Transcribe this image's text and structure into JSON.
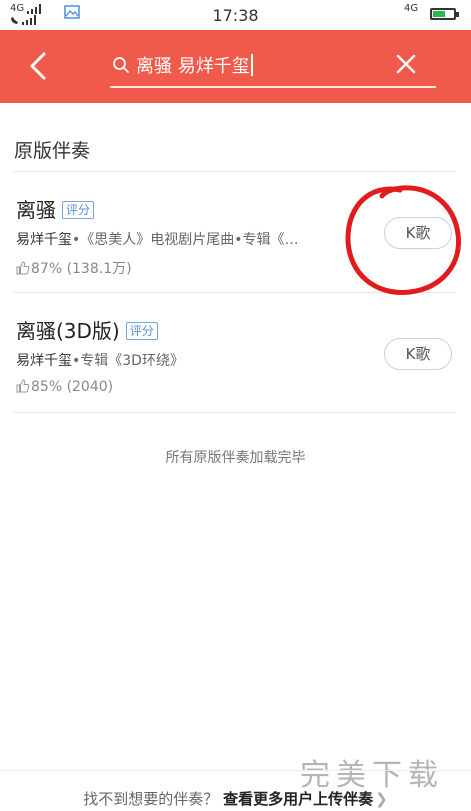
{
  "status_bar": {
    "network_left_top": "4G",
    "network_left_bottom": "",
    "time": "17:38",
    "network_right": "4G"
  },
  "header": {
    "search_value": "离骚 易烊千玺",
    "accent_color": "#f05a4b"
  },
  "section": {
    "title": "原版伴奏"
  },
  "songs": [
    {
      "title": "离骚",
      "badge": "评分",
      "artist": "易烊千玺",
      "album_info": "•《思美人》电视剧片尾曲•专辑《…",
      "rating": "87% (138.1万)",
      "action_label": "K歌"
    },
    {
      "title": "离骚(3D版)",
      "badge": "评分",
      "artist": "易烊千玺",
      "album_info": "•专辑《3D环绕》",
      "rating": "85% (2040)",
      "action_label": "K歌"
    }
  ],
  "footer_note": "所有原版伴奏加载完毕",
  "bottom_bar": {
    "question": "找不到想要的伴奏？",
    "link": "查看更多用户上传伴奏"
  },
  "watermark": "完美下载"
}
